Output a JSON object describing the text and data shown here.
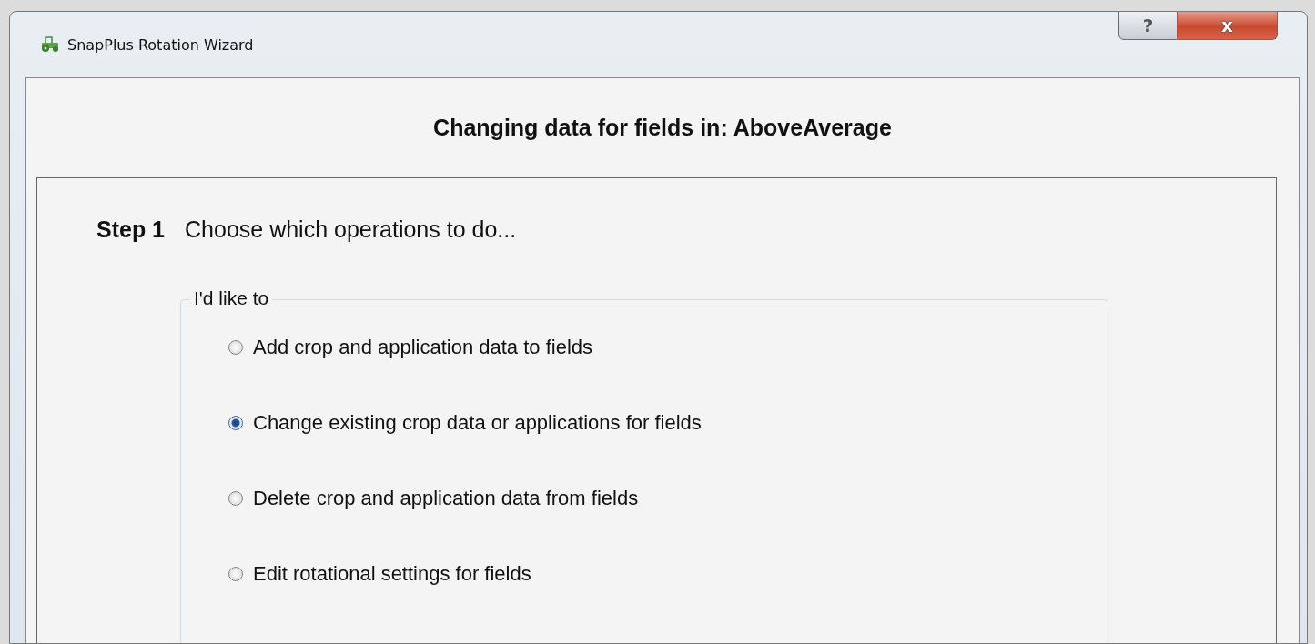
{
  "window": {
    "title": "SnapPlus Rotation Wizard",
    "buttons": [
      {
        "kind": "help",
        "label": "?"
      },
      {
        "kind": "close",
        "label": "x"
      }
    ]
  },
  "header": "Changing data for fields in: AboveAverage",
  "step": {
    "number": "Step 1",
    "instruction": "Choose which operations to do..."
  },
  "group": {
    "legend": "I'd like to",
    "options": [
      {
        "label": "Add crop and application data to fields",
        "selected": false
      },
      {
        "label": "Change existing crop data or applications for fields",
        "selected": true
      },
      {
        "label": "Delete crop and application data from fields",
        "selected": false
      },
      {
        "label": "Edit rotational settings for fields",
        "selected": false
      }
    ]
  }
}
